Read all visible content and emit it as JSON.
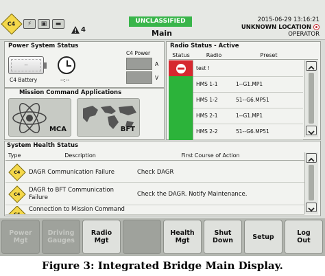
{
  "header": {
    "classification": "UNCLASSIFIED",
    "title": "Main",
    "datetime": "2015-06-29 13:16:21",
    "location": "UNKNOWN LOCATION",
    "role": "OPERATOR",
    "alert_count": "4",
    "logo_text": "C4"
  },
  "power": {
    "title": "Power System Status",
    "battery_label": "C4 Battery",
    "battery_value": "--",
    "time_value": "--:--",
    "c4_power_label": "C4 Power",
    "amp_unit": "A",
    "volt_unit": "V"
  },
  "mission": {
    "title": "Mission Command Applications",
    "apps": [
      {
        "label": "MCA"
      },
      {
        "label": "BFT"
      }
    ]
  },
  "radio": {
    "title": "Radio Status - Active",
    "columns": [
      "Status",
      "Radio",
      "Preset"
    ],
    "rows": [
      {
        "status": "red",
        "radio": "test !",
        "preset": ""
      },
      {
        "status": "green",
        "radio": "HMS 1-1",
        "preset": "1--G1.MP1"
      },
      {
        "status": "green",
        "radio": "HMS 1-2",
        "preset": "51--G6.MP51"
      },
      {
        "status": "green",
        "radio": "HMS 2-1",
        "preset": "1--G1.MP1"
      },
      {
        "status": "green",
        "radio": "HMS 2-2",
        "preset": "51--G6.MP51"
      }
    ]
  },
  "health": {
    "title": "System Health Status",
    "columns": [
      "Type",
      "Description",
      "First Course of Action"
    ],
    "rows": [
      {
        "type": "C4",
        "description": "DAGR Communication Failure",
        "action": "Check DAGR"
      },
      {
        "type": "C4",
        "description": "DAGR to BFT Communication Failure",
        "action": "Check the DAGR. Notify Maintenance."
      },
      {
        "type": "C4",
        "description": "Connection to Mission Command",
        "action": ""
      }
    ]
  },
  "buttons": [
    {
      "label": "Power\nMgt",
      "enabled": false
    },
    {
      "label": "Driving\nGauges",
      "enabled": false
    },
    {
      "label": "Radio\nMgt",
      "enabled": true
    },
    {
      "label": "",
      "enabled": false
    },
    {
      "label": "Health\nMgt",
      "enabled": true
    },
    {
      "label": "Shut\nDown",
      "enabled": true
    },
    {
      "label": "Setup",
      "enabled": true
    },
    {
      "label": "Log\nOut",
      "enabled": true
    }
  ],
  "caption": "Figure 3: Integrated Bridge Main Display."
}
